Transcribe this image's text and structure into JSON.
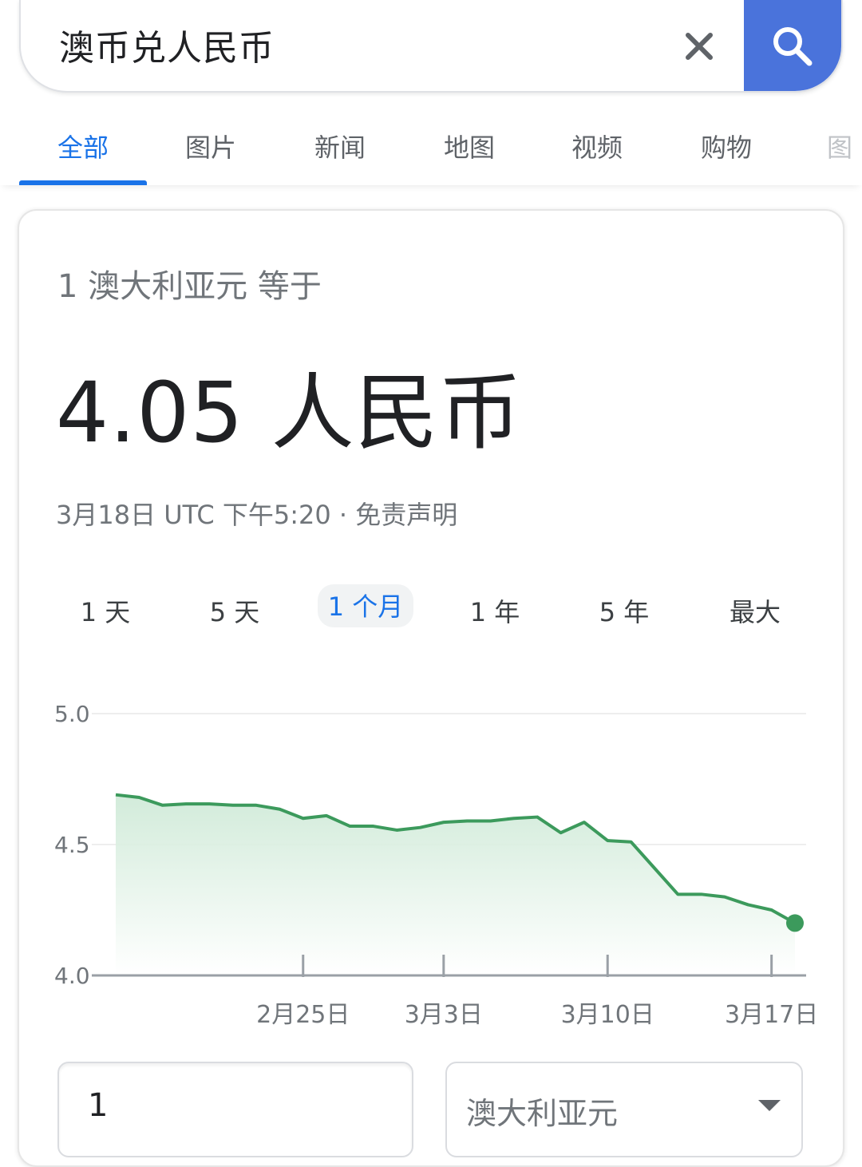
{
  "search": {
    "query": "澳币兑人民币",
    "clear_icon": "close-icon",
    "search_icon": "search-icon",
    "accent_color": "#4a73db"
  },
  "tabs": [
    {
      "label": "全部",
      "active": true
    },
    {
      "label": "图片"
    },
    {
      "label": "新闻"
    },
    {
      "label": "地图"
    },
    {
      "label": "视频"
    },
    {
      "label": "购物"
    },
    {
      "label": "图"
    }
  ],
  "converter": {
    "subtitle": "1 澳大利亚元 等于",
    "result": "4.05 人民币",
    "timestamp": "3月18日 UTC 下午5:20 · 免责声明",
    "periods": [
      "1 天",
      "5 天",
      "1 个月",
      "1 年",
      "5 年",
      "最大"
    ],
    "active_period": "1 个月",
    "amount": "1",
    "currency": "澳大利亚元"
  },
  "chart_data": {
    "type": "area",
    "x": [
      "2月17日",
      "2月18日",
      "2月19日",
      "2月20日",
      "2月21日",
      "2月22日",
      "2月23日",
      "2月24日",
      "2月25日",
      "2月26日",
      "2月27日",
      "2月28日",
      "3月1日",
      "3月2日",
      "3月3日",
      "3月4日",
      "3月5日",
      "3月6日",
      "3月7日",
      "3月8日",
      "3月9日",
      "3月10日",
      "3月11日",
      "3月12日",
      "3月13日",
      "3月14日",
      "3月15日",
      "3月16日",
      "3月17日",
      "3月18日"
    ],
    "values": [
      4.69,
      4.68,
      4.65,
      4.655,
      4.655,
      4.65,
      4.65,
      4.635,
      4.6,
      4.61,
      4.57,
      4.57,
      4.555,
      4.565,
      4.585,
      4.59,
      4.59,
      4.6,
      4.605,
      4.545,
      4.585,
      4.515,
      4.51,
      4.41,
      4.31,
      4.31,
      4.3,
      4.27,
      4.25,
      4.2
    ],
    "ylim": [
      4.0,
      5.0
    ],
    "yticks": [
      "5.0",
      "4.5",
      "4.0"
    ],
    "xticks": [
      "2月25日",
      "3月3日",
      "3月10日",
      "3月17日"
    ],
    "grid": true,
    "line_color": "#3c9a5c",
    "fill_color": "#e6f4ea"
  }
}
